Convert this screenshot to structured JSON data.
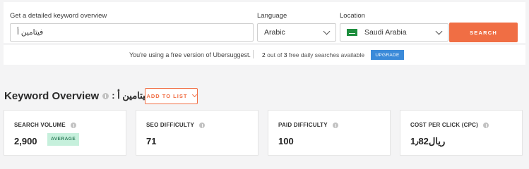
{
  "search": {
    "keyword_label": "Get a detailed keyword overview",
    "keyword_value": "فيتامين أ",
    "language_label": "Language",
    "language_value": "Arabic",
    "location_label": "Location",
    "location_value": "Saudi Arabia",
    "search_button": "SEARCH"
  },
  "free_bar": {
    "message": "You're using a free version of Ubersuggest.",
    "used": "2",
    "out_of_text": "out of",
    "total": "3",
    "suffix_text": "free daily searches available",
    "upgrade_button": "UPGRADE"
  },
  "overview": {
    "title": "Keyword Overview",
    "keyword": "فيتامين أ :",
    "add_to_list": "ADD TO LIST"
  },
  "metrics": [
    {
      "label": "SEARCH VOLUME",
      "value": "2,900",
      "badge": "AVERAGE"
    },
    {
      "label": "SEO DIFFICULTY",
      "value": "71"
    },
    {
      "label": "PAID DIFFICULTY",
      "value": "100"
    },
    {
      "label": "COST PER CLICK (CPC)",
      "value": "ريال1٫82"
    }
  ],
  "colors": {
    "accent": "#f06e44",
    "upgrade": "#3b8ad9",
    "badge_bg": "#c6f0dc",
    "badge_text": "#2a7a57"
  },
  "icons": [
    "chevron-down-icon",
    "saudi-flag-icon",
    "info-icon"
  ]
}
